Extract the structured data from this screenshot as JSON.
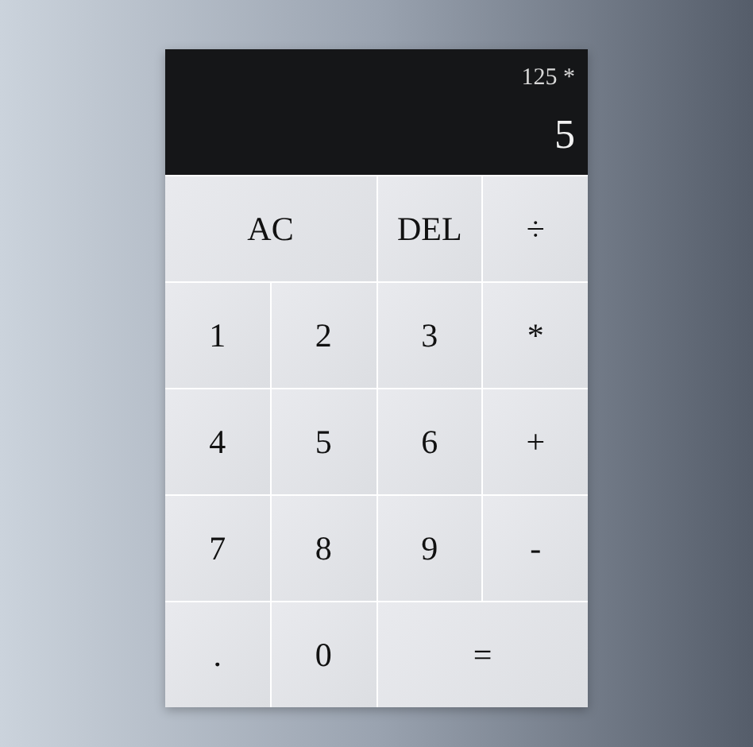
{
  "display": {
    "previous": "125 *",
    "current": "5"
  },
  "keys": [
    {
      "label": "AC",
      "kind": "wide"
    },
    {
      "label": "DEL",
      "kind": "single"
    },
    {
      "label": "÷",
      "kind": "single"
    },
    {
      "label": "1",
      "kind": "single"
    },
    {
      "label": "2",
      "kind": "single"
    },
    {
      "label": "3",
      "kind": "single"
    },
    {
      "label": "*",
      "kind": "single"
    },
    {
      "label": "4",
      "kind": "single"
    },
    {
      "label": "5",
      "kind": "single"
    },
    {
      "label": "6",
      "kind": "single"
    },
    {
      "label": "+",
      "kind": "single"
    },
    {
      "label": "7",
      "kind": "single"
    },
    {
      "label": "8",
      "kind": "single"
    },
    {
      "label": "9",
      "kind": "single"
    },
    {
      "label": "-",
      "kind": "single"
    },
    {
      "label": ".",
      "kind": "single"
    },
    {
      "label": "0",
      "kind": "single"
    },
    {
      "label": "=",
      "kind": "wide"
    }
  ]
}
